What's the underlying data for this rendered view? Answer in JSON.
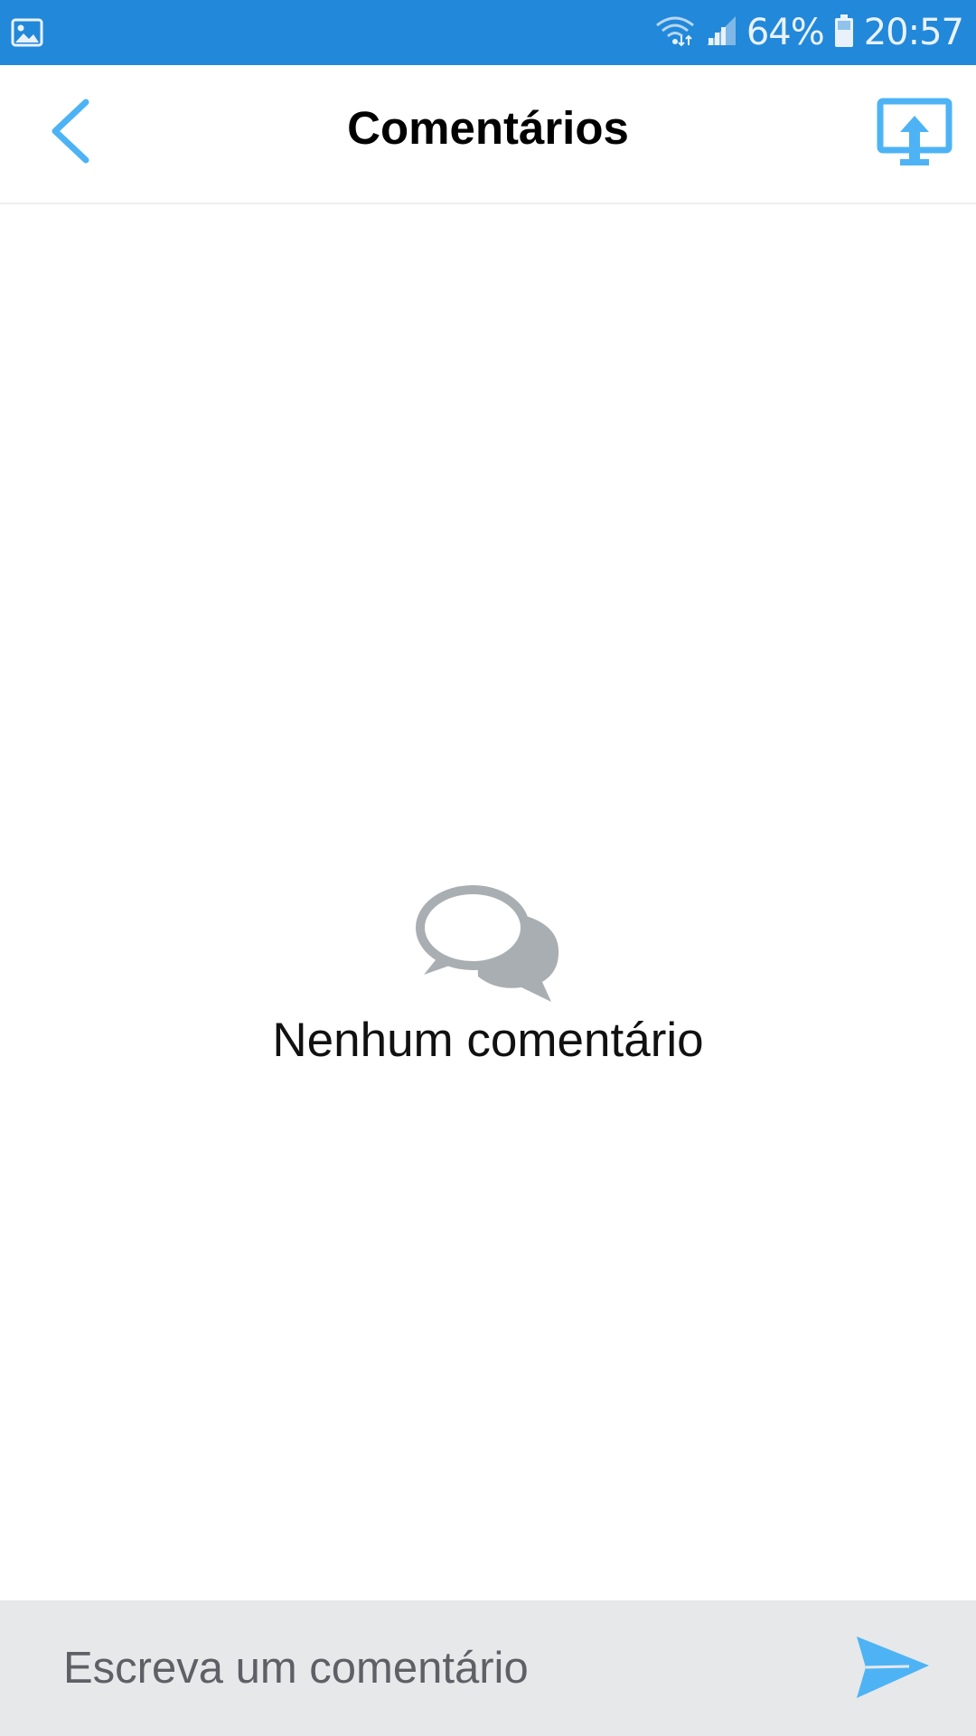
{
  "status_bar": {
    "battery_text": "64%",
    "time_text": "20:57",
    "left_icon": "gallery-icon",
    "icons": [
      "wifi-icon",
      "signal-icon",
      "battery-icon"
    ]
  },
  "header": {
    "title": "Comentários",
    "back_icon": "chevron-left-icon",
    "share_icon": "screen-share-icon"
  },
  "empty_state": {
    "icon": "chat-bubbles-icon",
    "message": "Nenhum comentário"
  },
  "composer": {
    "placeholder": "Escreva um comentário",
    "value": "",
    "send_icon": "send-icon"
  },
  "colors": {
    "status_bar": "#2288d9",
    "accent": "#4db3f5",
    "empty_icon": "#a9aeb2",
    "composer_bg": "#e7e8ea"
  }
}
